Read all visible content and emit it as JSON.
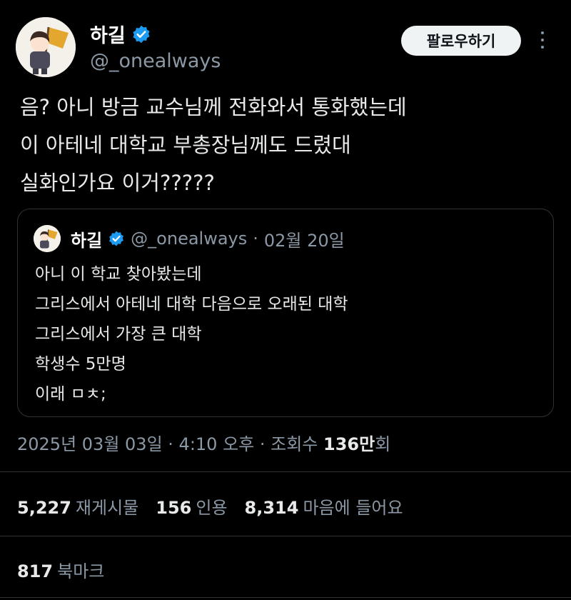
{
  "author": {
    "name": "하길",
    "handle": "@_onealways",
    "verified_color": "#1d9bf0"
  },
  "follow_label": "팔로우하기",
  "tweet_lines": [
    "음? 아니 방금 교수님께 전화와서 통화했는데",
    "이 아테네 대학교 부총장님께도 드렸대",
    "실화인가요 이거?????"
  ],
  "quote": {
    "name": "하길",
    "handle": "@_onealways",
    "separator": "·",
    "date": "02월 20일",
    "lines": [
      "아니 이 학교 찾아봤는데",
      "그리스에서 아테네 대학 다음으로 오래된 대학",
      "그리스에서 가장 큰 대학",
      "학생수 5만명",
      "이래 ㅁㅊ;"
    ]
  },
  "meta": {
    "date": "2025년 03월 03일",
    "sep1": " · ",
    "time": "4:10 오후",
    "sep2": " · ",
    "views_label": "조회수 ",
    "views_count": "136만",
    "views_suffix": "회"
  },
  "stats": [
    {
      "num": "5,227",
      "label": "재게시물"
    },
    {
      "num": "156",
      "label": "인용"
    },
    {
      "num": "8,314",
      "label": "마음에 들어요"
    }
  ],
  "bookmarks": {
    "num": "817",
    "label": "북마크"
  },
  "colors": {
    "background": "#000000",
    "text": "#e7e9ea",
    "muted": "#8b98a5",
    "border": "#2f3336"
  }
}
